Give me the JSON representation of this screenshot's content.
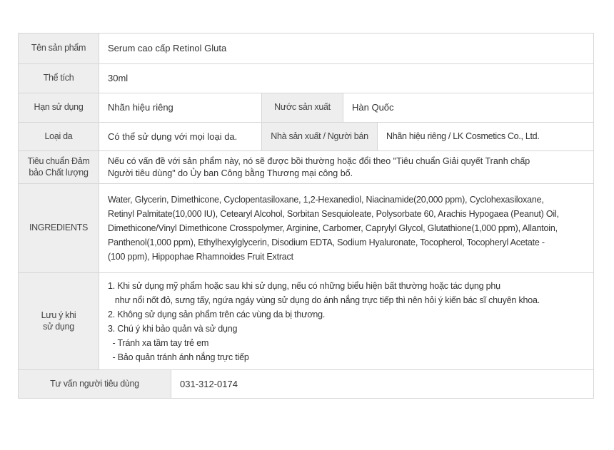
{
  "product_name": {
    "label": "Tên sản phẩm",
    "value": "Serum cao cấp Retinol Gluta"
  },
  "volume": {
    "label": "Thể tích",
    "value": "30ml"
  },
  "expiry": {
    "label": "Hạn sử dụng",
    "value": "Nhãn hiệu riêng"
  },
  "origin": {
    "label": "Nước sản xuất",
    "value": "Hàn Quốc"
  },
  "skin_type": {
    "label": "Loại da",
    "value": "Có thể sử dụng với mọi loại da."
  },
  "manufacturer": {
    "label": "Nhà sản xuất / Người bán",
    "value": "Nhãn hiệu riêng / LK Cosmetics Co., Ltd."
  },
  "quality_standard": {
    "label_lines": [
      "Tiêu chuẩn Đảm",
      "bảo Chất lượng"
    ],
    "value_lines": [
      "Nếu có vấn đề với sản phẩm này, nó sẽ được bồi thường hoặc đổi theo \"Tiêu chuẩn Giải quyết Tranh chấp",
      "Người tiêu dùng\" do Ủy ban Công bằng Thương mại công bố."
    ]
  },
  "ingredients": {
    "label": "INGREDIENTS",
    "value_lines": [
      "Water, Glycerin, Dimethicone, Cyclopentasiloxane, 1,2-Hexanediol, Niacinamide(20,000 ppm), Cyclohexasiloxane,",
      "Retinyl Palmitate(10,000 IU), Cetearyl Alcohol, Sorbitan Sesquioleate, Polysorbate 60, Arachis Hypogaea (Peanut) Oil,",
      "Dimethicone/Vinyl Dimethicone Crosspolymer, Arginine, Carbomer, Caprylyl Glycol, Glutathione(1,000 ppm), Allantoin,",
      "Panthenol(1,000 ppm), Ethylhexylglycerin, Disodium EDTA, Sodium Hyaluronate, Tocopherol, Tocopheryl Acetate -",
      "(100 ppm), Hippophae Rhamnoides Fruit Extract"
    ]
  },
  "usage_notes": {
    "label_lines": [
      "Lưu ý khi",
      "sử dụng"
    ],
    "lines": [
      "1. Khi sử dụng mỹ phẩm hoặc sau khi sử dụng, nếu có những biểu hiện bất thường hoặc tác dụng phụ",
      "   như nổi nốt đỏ, sưng tấy, ngứa ngáy vùng sử dụng do ánh nắng trực tiếp thì nên hỏi ý kiến bác sĩ chuyên khoa.",
      "2. Không sử dụng sản phẩm trên các vùng da bị thương.",
      "3. Chú ý khi bảo quản và sử dụng",
      "  - Tránh xa tầm tay trẻ em",
      "  - Bảo quản tránh ánh nắng trực tiếp"
    ]
  },
  "consult": {
    "label": "Tư vấn người tiêu dùng",
    "value": "031-312-0174"
  }
}
